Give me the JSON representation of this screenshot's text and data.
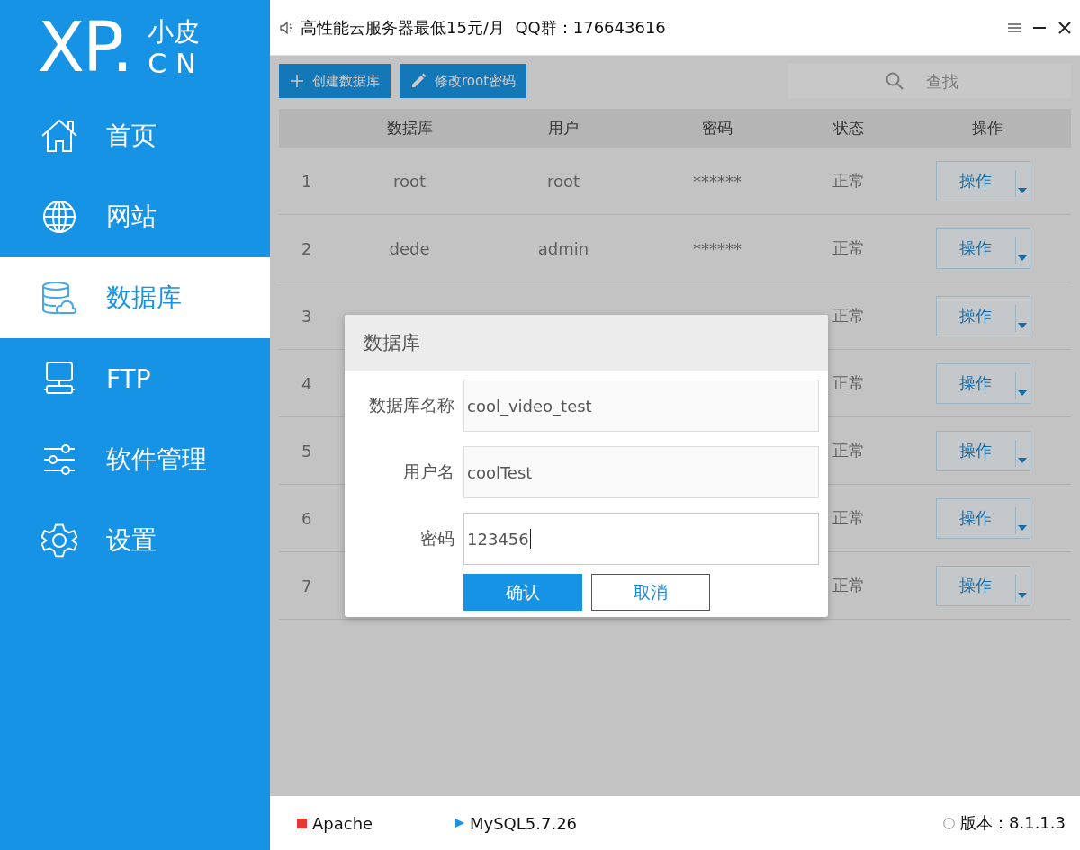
{
  "logo": {
    "mark": "XP.",
    "top": "小皮",
    "bottom": "CN"
  },
  "sidebar": {
    "items": [
      {
        "label": "首页",
        "selected": false
      },
      {
        "label": "网站",
        "selected": false
      },
      {
        "label": "数据库",
        "selected": true
      },
      {
        "label": "FTP",
        "selected": false
      },
      {
        "label": "软件管理",
        "selected": false
      },
      {
        "label": "设置",
        "selected": false
      }
    ]
  },
  "topbar": {
    "notice": "高性能云服务器最低15元/月  QQ群：176643616"
  },
  "toolbar": {
    "buttons": [
      "创建数据库",
      "修改root密码"
    ],
    "search": {
      "placeholder": "查找"
    }
  },
  "table": {
    "columns": [
      "数据库",
      "用户",
      "密码",
      "状态",
      "操作"
    ],
    "rows": [
      {
        "index": "1",
        "database": "root",
        "user": "root",
        "password": "******",
        "status": "正常",
        "action": "操作"
      },
      {
        "index": "2",
        "database": "dede",
        "user": "admin",
        "password": "******",
        "status": "正常",
        "action": "操作"
      },
      {
        "index": "3",
        "status": "正常",
        "action": "操作"
      },
      {
        "index": "4",
        "status": "正常",
        "action": "操作"
      },
      {
        "index": "5",
        "status": "正常",
        "action": "操作"
      },
      {
        "index": "6",
        "status": "正常",
        "action": "操作"
      },
      {
        "index": "7",
        "status": "正常",
        "action": "操作"
      }
    ]
  },
  "dialog": {
    "title": "数据库",
    "fields": [
      {
        "label": "数据库名称",
        "value": "cool_video_test",
        "focused": false
      },
      {
        "label": "用户名",
        "value": "coolTest",
        "focused": false
      },
      {
        "label": "密码",
        "value": "123456",
        "focused": true
      }
    ],
    "buttons": [
      {
        "label": "确认",
        "kind": "primary"
      },
      {
        "label": "取消",
        "kind": "secondary"
      }
    ]
  },
  "status_bar": {
    "services": [
      {
        "name": "Apache",
        "running": false
      },
      {
        "name": "MySQL5.7.26",
        "running": true
      }
    ],
    "version": "版本：8.1.1.3"
  }
}
